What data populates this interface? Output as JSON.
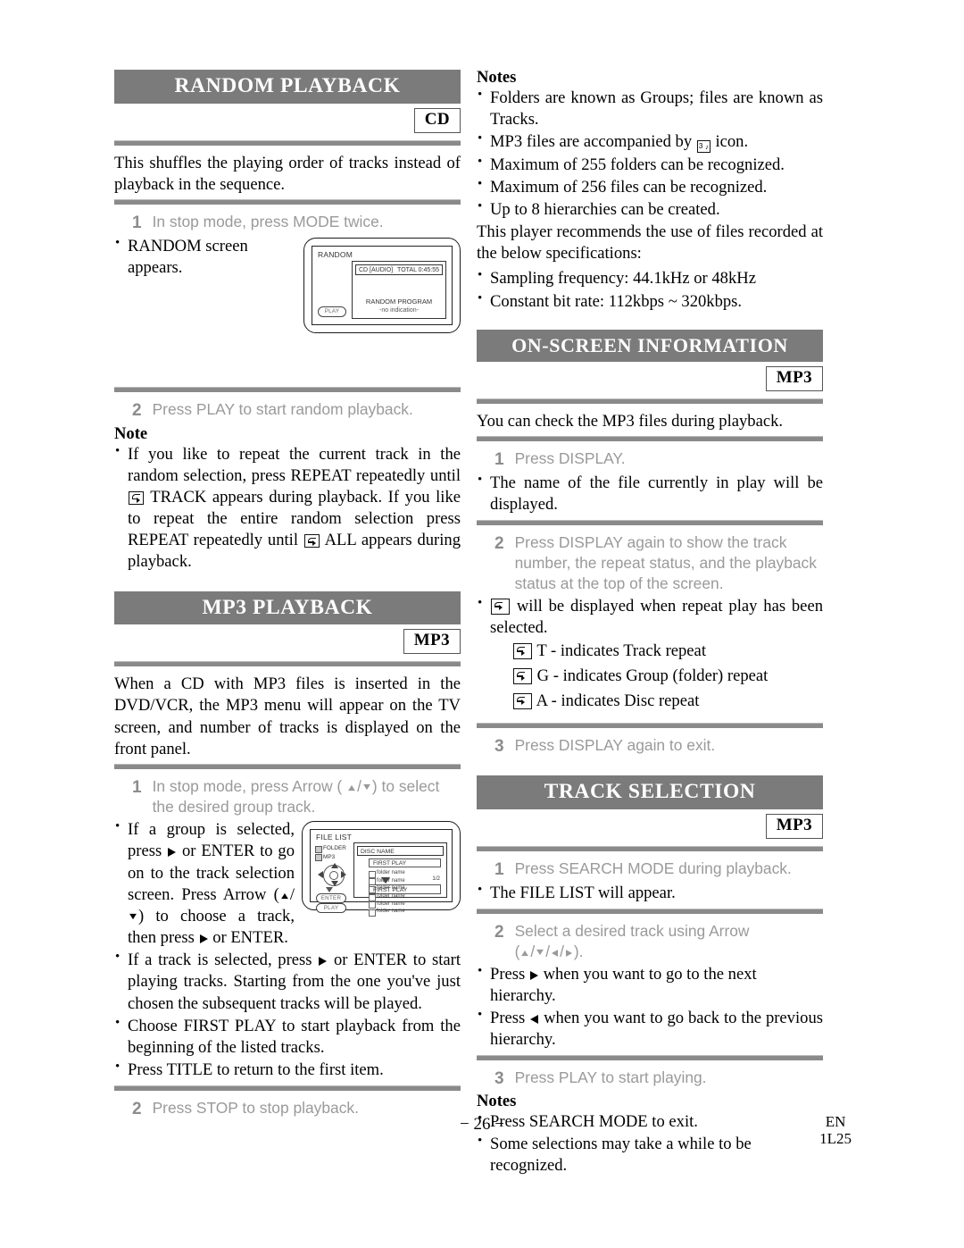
{
  "left_column": {
    "random_playback": {
      "title": "RANDOM PLAYBACK",
      "badge": "CD",
      "intro": "This shuffles the playing order of tracks instead of playback in the sequence.",
      "step1_num": "1",
      "step1_text": "In stop mode, press MODE twice.",
      "bullet1": "RANDOM screen appears.",
      "random_screen": {
        "title": "RANDOM",
        "disc_label": "CD [AUDIO]",
        "total_label": "TOTAL 0:45:55",
        "program_label": "RANDOM PROGRAM",
        "no_indication": "-no indication-",
        "play_button": "PLAY"
      },
      "step2_num": "2",
      "step2_text": "Press PLAY to start random playback.",
      "note_heading": "Note",
      "note_part1": "If you like to repeat the current track in the random selection, press REPEAT repeatedly until",
      "note_part2": "TRACK appears during playback. If you like to repeat the entire random selection press REPEAT repeatedly until",
      "note_part3": "ALL appears during playback."
    },
    "mp3_playback": {
      "title": "MP3 PLAYBACK",
      "badge": "MP3",
      "intro": "When a CD with MP3 files is inserted in the DVD/VCR, the MP3 menu will appear on the TV screen, and number of tracks is displayed on the front panel.",
      "step1_num": "1",
      "step1_text_a": "In stop mode, press Arrow (",
      "step1_text_b": ") to select the desired group track.",
      "file_list_screen": {
        "title": "FILE LIST",
        "legend": [
          "FOLDER",
          "MP3"
        ],
        "disc_name": "DISC NAME",
        "first_play_top": "FIRST PLAY",
        "items": [
          "folder name",
          "folder name",
          "folder name",
          "folder name",
          "folder name",
          "folder name"
        ],
        "page_indicator": "1/2",
        "first_play_bottom": "FIRST PLAY",
        "enter_button": "ENTER",
        "play_button": "PLAY"
      },
      "bullet1_a": "If a group is selected, press",
      "bullet1_b": "or ENTER to go on to the track selection screen. Press Arrow (",
      "bullet1_c": ") to choose a track, then press",
      "bullet1_d": "or ENTER.",
      "bullet2_a": "If a track is selected, press",
      "bullet2_b": "or ENTER to start playing tracks. Starting from the one you've just chosen the subsequent tracks will be played.",
      "bullet3": "Choose FIRST PLAY to start playback from the beginning of the listed tracks.",
      "bullet4": "Press TITLE to return to the first item.",
      "step2_num": "2",
      "step2_text": "Press STOP to stop playback."
    }
  },
  "right_column": {
    "notes_top": {
      "heading": "Notes",
      "items_a": "Folders are known as Groups; files are known as Tracks.",
      "items_b_1": "MP3 files are accompanied by",
      "items_b_2": "icon.",
      "items_c": "Maximum of 255 folders can be recognized.",
      "items_d": "Maximum of 256 files can be recognized.",
      "items_e": "Up to 8 hierarchies can be created.",
      "paragraph": "This player recommends the use of files recorded at the below specifications:",
      "items_f": "Sampling frequency: 44.1kHz or 48kHz",
      "items_g": "Constant bit rate: 112kbps ~ 320kbps."
    },
    "on_screen_information": {
      "title": "ON-SCREEN INFORMATION",
      "badge": "MP3",
      "intro": "You can check the MP3 files during playback.",
      "step1_num": "1",
      "step1_text": "Press DISPLAY.",
      "bullet1": "The name of the file currently in play will be displayed.",
      "step2_num": "2",
      "step2_text": "Press DISPLAY again to show the track number, the repeat status, and the playback status at the top of the screen.",
      "bullet2": "will be displayed when repeat play has been selected.",
      "repeat_t": "T - indicates Track repeat",
      "repeat_g": "G - indicates Group (folder) repeat",
      "repeat_a": "A - indicates Disc repeat",
      "step3_num": "3",
      "step3_text": "Press DISPLAY again to exit."
    },
    "track_selection": {
      "title": "TRACK SELECTION",
      "badge": "MP3",
      "step1_num": "1",
      "step1_text": "Press SEARCH MODE during playback.",
      "bullet1": "The FILE LIST will appear.",
      "step2_num": "2",
      "step2_text_a": "Select a desired track using Arrow",
      "step2_text_b": "(",
      "step2_text_c": ").",
      "bullet2_a": "Press",
      "bullet2_b": "when you want to go to the next hierarchy.",
      "bullet3_a": "Press",
      "bullet3_b": "when you want to go back to the previous hierarchy.",
      "step3_num": "3",
      "step3_text": "Press PLAY to start playing.",
      "notes_heading": "Notes",
      "note1": "Press SEARCH MODE to exit.",
      "note2": "Some selections may take a while to be recognized."
    }
  },
  "footer": {
    "page_number": "− 26 −",
    "lang_code": "EN",
    "doc_code": "1L25"
  },
  "colors": {
    "header_bar": "#7b7b7b",
    "rule": "#8a8a8a",
    "step_gray": "#9a9a9a"
  }
}
